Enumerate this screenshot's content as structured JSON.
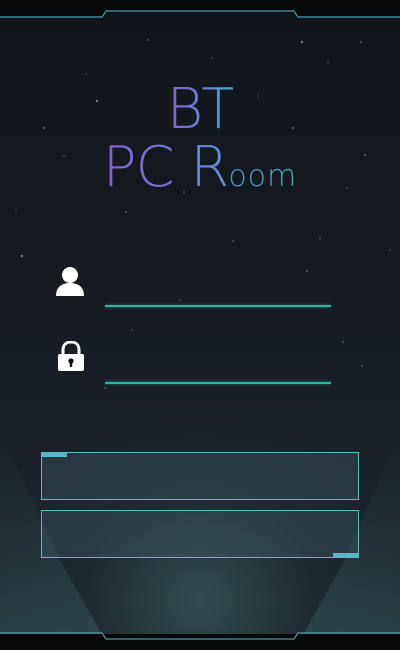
{
  "logo": {
    "line1": "BT",
    "line2_main": "PC R",
    "line2_small": "oom"
  },
  "username": {
    "icon": "user-icon",
    "value": "",
    "placeholder": ""
  },
  "password": {
    "icon": "lock-icon",
    "value": "",
    "placeholder": ""
  },
  "buttons": [
    {
      "label": ""
    },
    {
      "label": ""
    }
  ],
  "colors": {
    "background": "#161b22",
    "accent": "#2fb1a4",
    "frame": "#5fb6c9",
    "logo_gradient_start": "#8a5bd8",
    "logo_gradient_end": "#3fb6c4"
  }
}
